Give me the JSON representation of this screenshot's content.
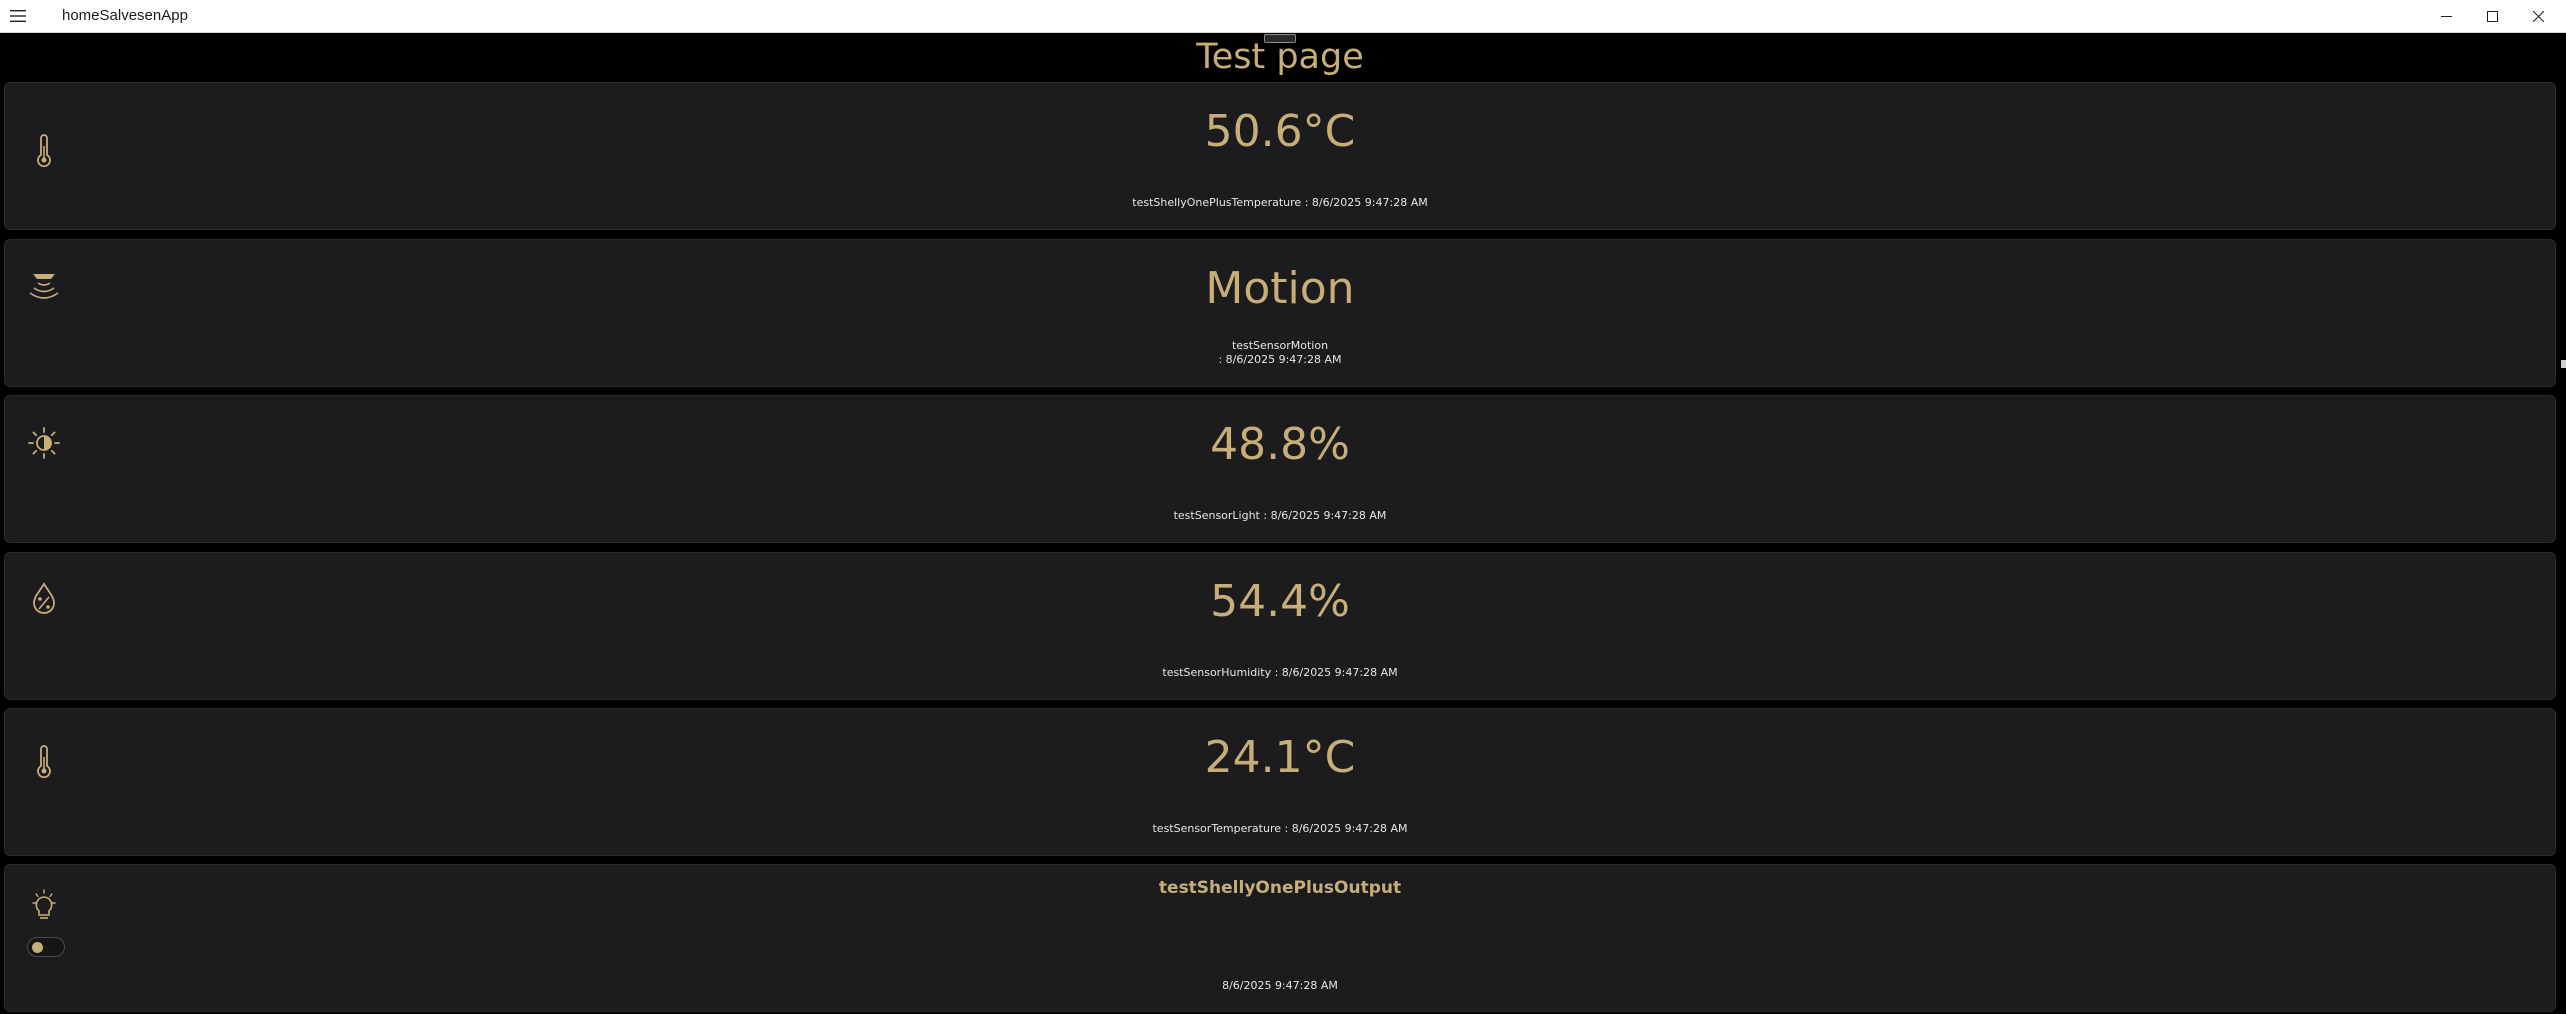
{
  "window": {
    "title": "homeSalvesenApp",
    "controls": [
      "minimize",
      "maximize",
      "close"
    ]
  },
  "page": {
    "title": "Test page"
  },
  "colors": {
    "accent": "#c7ae78",
    "card_bg": "#1c1c1e",
    "page_bg": "#000000",
    "caption_text": "#e6e6e6"
  },
  "cards": [
    {
      "icon": "thermometer-icon",
      "value": "50.6°C",
      "caption": "testShellyOnePlusTemperature : 8/6/2025 9:47:28 AM"
    },
    {
      "icon": "motion-sensor-icon",
      "value": "Motion",
      "caption_line1": "testSensorMotion",
      "caption_line2": ": 8/6/2025 9:47:28 AM"
    },
    {
      "icon": "brightness-icon",
      "value": "48.8%",
      "caption": "testSensorLight : 8/6/2025 9:47:28 AM"
    },
    {
      "icon": "humidity-icon",
      "value": "54.4%",
      "caption": "testSensorHumidity : 8/6/2025 9:47:28 AM"
    },
    {
      "icon": "thermometer-icon",
      "value": "24.1°C",
      "caption": "testSensorTemperature : 8/6/2025 9:47:28 AM"
    },
    {
      "icon": "lightbulb-icon",
      "title": "testShellyOnePlusOutput",
      "toggle_state": "off",
      "caption": "8/6/2025 9:47:28 AM"
    }
  ]
}
